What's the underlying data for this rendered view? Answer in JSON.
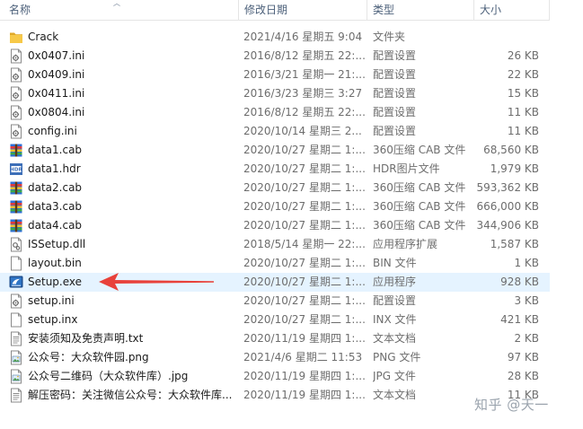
{
  "header": {
    "name": "名称",
    "date": "修改日期",
    "type": "类型",
    "size": "大小"
  },
  "files": [
    {
      "name": "Crack",
      "date": "2021/4/16 星期五 9:04",
      "type": "文件夹",
      "size": "",
      "icon": "folder-icon"
    },
    {
      "name": "0x0407.ini",
      "date": "2016/8/12 星期五 22:...",
      "type": "配置设置",
      "size": "26 KB",
      "icon": "config-file-icon"
    },
    {
      "name": "0x0409.ini",
      "date": "2016/3/21 星期一 21:...",
      "type": "配置设置",
      "size": "22 KB",
      "icon": "config-file-icon"
    },
    {
      "name": "0x0411.ini",
      "date": "2016/3/23 星期三 3:27",
      "type": "配置设置",
      "size": "15 KB",
      "icon": "config-file-icon"
    },
    {
      "name": "0x0804.ini",
      "date": "2016/8/12 星期五 22:...",
      "type": "配置设置",
      "size": "11 KB",
      "icon": "config-file-icon"
    },
    {
      "name": "config.ini",
      "date": "2020/10/14 星期三 2...",
      "type": "配置设置",
      "size": "11 KB",
      "icon": "config-file-icon"
    },
    {
      "name": "data1.cab",
      "date": "2020/10/27 星期二 1:...",
      "type": "360压缩 CAB 文件",
      "size": "68,560 KB",
      "icon": "archive-icon"
    },
    {
      "name": "data1.hdr",
      "date": "2020/10/27 星期二 1:...",
      "type": "HDR图片文件",
      "size": "1,979 KB",
      "icon": "hdr-file-icon"
    },
    {
      "name": "data2.cab",
      "date": "2020/10/27 星期二 1:...",
      "type": "360压缩 CAB 文件",
      "size": "593,362 KB",
      "icon": "archive-icon"
    },
    {
      "name": "data3.cab",
      "date": "2020/10/27 星期二 1:...",
      "type": "360压缩 CAB 文件",
      "size": "666,000 KB",
      "icon": "archive-icon"
    },
    {
      "name": "data4.cab",
      "date": "2020/10/27 星期二 1:...",
      "type": "360压缩 CAB 文件",
      "size": "344,906 KB",
      "icon": "archive-icon"
    },
    {
      "name": "ISSetup.dll",
      "date": "2018/5/14 星期一 22:...",
      "type": "应用程序扩展",
      "size": "1,587 KB",
      "icon": "dll-file-icon"
    },
    {
      "name": "layout.bin",
      "date": "2020/10/27 星期二 1:...",
      "type": "BIN 文件",
      "size": "1 KB",
      "icon": "blank-file-icon"
    },
    {
      "name": "Setup.exe",
      "date": "2020/10/27 星期二 1:...",
      "type": "应用程序",
      "size": "928 KB",
      "icon": "setup-app-icon",
      "highlight": true
    },
    {
      "name": "setup.ini",
      "date": "2020/10/27 星期二 1:...",
      "type": "配置设置",
      "size": "3 KB",
      "icon": "config-file-icon"
    },
    {
      "name": "setup.inx",
      "date": "2020/10/27 星期二 1:...",
      "type": "INX 文件",
      "size": "421 KB",
      "icon": "blank-file-icon"
    },
    {
      "name": "安装须知及免责声明.txt",
      "date": "2020/11/19 星期四 1:...",
      "type": "文本文档",
      "size": "2 KB",
      "icon": "text-file-icon"
    },
    {
      "name": "公众号：大众软件园.png",
      "date": "2021/4/6 星期二 11:53",
      "type": "PNG 文件",
      "size": "97 KB",
      "icon": "image-file-icon"
    },
    {
      "name": "公众号二维码（大众软件库）.jpg",
      "date": "2020/11/19 星期四 1:...",
      "type": "JPG 文件",
      "size": "28 KB",
      "icon": "image-file-icon"
    },
    {
      "name": "解压密码：关注微信公众号：大众软件库...",
      "date": "2020/11/19 星期四 1:...",
      "type": "文本文档",
      "size": "11 KB",
      "icon": "text-file-icon"
    }
  ],
  "watermark": "知乎 @天一",
  "colors": {
    "header_text": "#4c607a",
    "hover_row": "#e5f3ff",
    "arrow": "#e8413a",
    "folder": "#f5c542"
  }
}
